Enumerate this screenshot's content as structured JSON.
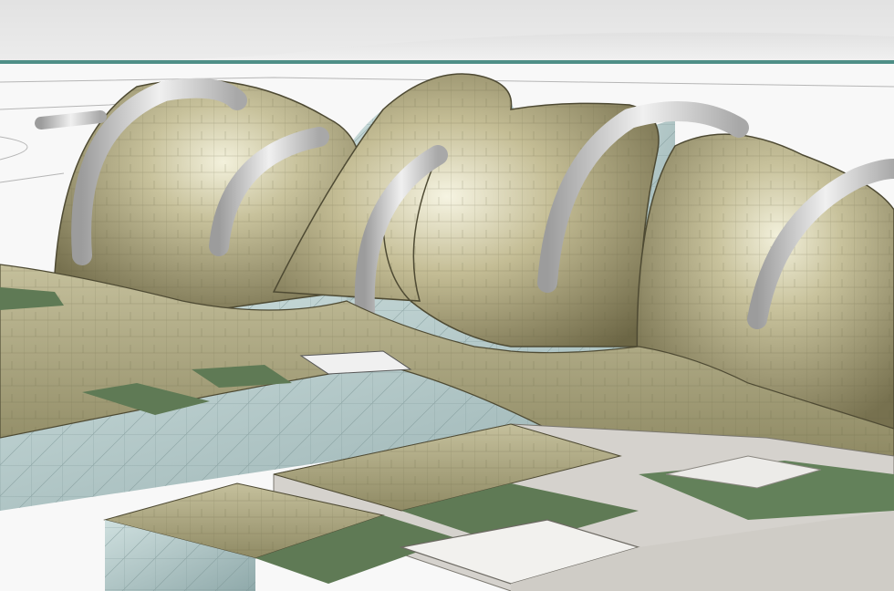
{
  "scene": {
    "subject": "architectural-rendering",
    "palette": {
      "sky": "#d9d9d9",
      "sky_light": "#f4f4f4",
      "ground": "#ffffff",
      "shell_gold": "#b9b38e",
      "shell_light": "#e6e4cc",
      "shell_dark": "#6f6a4a",
      "glass": "#b9cfd0",
      "glass_dark": "#8aa8aa",
      "arch_silver": "#d8d8d8",
      "arch_shadow": "#9a9a9a",
      "roof_green": "#5f7a55",
      "plaza_grey": "#d5d2cd",
      "horizon_teal": "#4f8f87"
    }
  }
}
